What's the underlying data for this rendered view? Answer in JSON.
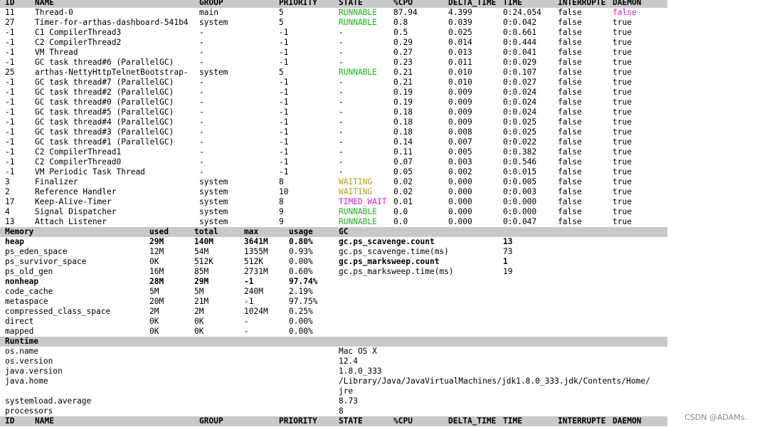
{
  "thread_table": {
    "columns": [
      "ID",
      "NAME",
      "GROUP",
      "PRIORITY",
      "STATE",
      "%CPU",
      "DELTA_TIME",
      "TIME",
      "INTERRUPTE",
      "DAEMON"
    ],
    "rows": [
      [
        "11",
        "Thread-0",
        "main",
        "5",
        "RUNNABLE",
        "87.94",
        "4.399",
        "0:24.054",
        "false",
        "false"
      ],
      [
        "27",
        "Timer-for-arthas-dashboard-541b4",
        "system",
        "5",
        "RUNNABLE",
        "0.8",
        "0.039",
        "0:0.042",
        "false",
        "true"
      ],
      [
        "-1",
        "C1 CompilerThread3",
        "-",
        "-1",
        "-",
        "0.5",
        "0.025",
        "0:0.661",
        "false",
        "true"
      ],
      [
        "-1",
        "C2 CompilerThread2",
        "-",
        "-1",
        "-",
        "0.29",
        "0.014",
        "0:0.444",
        "false",
        "true"
      ],
      [
        "-1",
        "VM Thread",
        "-",
        "-1",
        "-",
        "0.27",
        "0.013",
        "0:0.041",
        "false",
        "true"
      ],
      [
        "-1",
        "GC task thread#6 (ParallelGC)",
        "-",
        "-1",
        "-",
        "0.23",
        "0.011",
        "0:0.029",
        "false",
        "true"
      ],
      [
        "25",
        "arthas-NettyHttpTelnetBootstrap-",
        "system",
        "5",
        "RUNNABLE",
        "0.21",
        "0.010",
        "0:0.107",
        "false",
        "true"
      ],
      [
        "-1",
        "GC task thread#7 (ParallelGC)",
        "-",
        "-1",
        "-",
        "0.21",
        "0.010",
        "0:0.027",
        "false",
        "true"
      ],
      [
        "-1",
        "GC task thread#2 (ParallelGC)",
        "-",
        "-1",
        "-",
        "0.19",
        "0.009",
        "0:0.024",
        "false",
        "true"
      ],
      [
        "-1",
        "GC task thread#0 (ParallelGC)",
        "-",
        "-1",
        "-",
        "0.19",
        "0.009",
        "0:0.024",
        "false",
        "true"
      ],
      [
        "-1",
        "GC task thread#5 (ParallelGC)",
        "-",
        "-1",
        "-",
        "0.18",
        "0.009",
        "0:0.024",
        "false",
        "true"
      ],
      [
        "-1",
        "GC task thread#4 (ParallelGC)",
        "-",
        "-1",
        "-",
        "0.18",
        "0.009",
        "0:0.025",
        "false",
        "true"
      ],
      [
        "-1",
        "GC task thread#3 (ParallelGC)",
        "-",
        "-1",
        "-",
        "0.18",
        "0.008",
        "0:0.025",
        "false",
        "true"
      ],
      [
        "-1",
        "GC task thread#1 (ParallelGC)",
        "-",
        "-1",
        "-",
        "0.14",
        "0.007",
        "0:0.022",
        "false",
        "true"
      ],
      [
        "-1",
        "C2 CompilerThread1",
        "-",
        "-1",
        "-",
        "0.11",
        "0.005",
        "0:0.382",
        "false",
        "true"
      ],
      [
        "-1",
        "C2 CompilerThread0",
        "-",
        "-1",
        "-",
        "0.07",
        "0.003",
        "0:0.546",
        "false",
        "true"
      ],
      [
        "-1",
        "VM Periodic Task Thread",
        "-",
        "-1",
        "-",
        "0.05",
        "0.002",
        "0:0.015",
        "false",
        "true"
      ],
      [
        "3",
        "Finalizer",
        "system",
        "8",
        "WAITING",
        "0.02",
        "0.000",
        "0:0.005",
        "false",
        "true"
      ],
      [
        "2",
        "Reference Handler",
        "system",
        "10",
        "WAITING",
        "0.02",
        "0.000",
        "0:0.003",
        "false",
        "true"
      ],
      [
        "17",
        "Keep-Alive-Timer",
        "system",
        "8",
        "TIMED_WAIT",
        "0.01",
        "0.000",
        "0:0.000",
        "false",
        "true"
      ],
      [
        "4",
        "Signal Dispatcher",
        "system",
        "9",
        "RUNNABLE",
        "0.0",
        "0.000",
        "0:0.000",
        "false",
        "true"
      ],
      [
        "13",
        "Attach Listener",
        "system",
        "9",
        "RUNNABLE",
        "0.0",
        "0.000",
        "0:0.047",
        "false",
        "true"
      ]
    ]
  },
  "memory_header": [
    "Memory",
    "used",
    "total",
    "max",
    "usage",
    "GC"
  ],
  "memory_rows": [
    {
      "name": "heap",
      "used": "29M",
      "total": "140M",
      "max": "3641M",
      "usage": "0.80%",
      "bold": true
    },
    {
      "name": "ps_eden_space",
      "used": "12M",
      "total": "54M",
      "max": "1355M",
      "usage": "0.93%"
    },
    {
      "name": "ps_survivor_space",
      "used": "0K",
      "total": "512K",
      "max": "512K",
      "usage": "0.00%"
    },
    {
      "name": "ps_old_gen",
      "used": "16M",
      "total": "85M",
      "max": "2731M",
      "usage": "0.60%"
    },
    {
      "name": "nonheap",
      "used": "28M",
      "total": "29M",
      "max": "-1",
      "usage": "97.74%",
      "bold": true
    },
    {
      "name": "code_cache",
      "used": "5M",
      "total": "5M",
      "max": "240M",
      "usage": "2.19%"
    },
    {
      "name": "metaspace",
      "used": "20M",
      "total": "21M",
      "max": "-1",
      "usage": "97.75%"
    },
    {
      "name": "compressed_class_space",
      "used": "2M",
      "total": "2M",
      "max": "1024M",
      "usage": "0.25%"
    },
    {
      "name": "direct",
      "used": "0K",
      "total": "0K",
      "max": "-",
      "usage": "0.00%"
    },
    {
      "name": "mapped",
      "used": "0K",
      "total": "0K",
      "max": "-",
      "usage": "0.00%"
    }
  ],
  "gc_rows": [
    {
      "name": "gc.ps_scavenge.count",
      "value": "13",
      "bold": true
    },
    {
      "name": "gc.ps_scavenge.time(ms)",
      "value": "73"
    },
    {
      "name": "gc.ps_marksweep.count",
      "value": "1",
      "bold": true
    },
    {
      "name": "gc.ps_marksweep.time(ms)",
      "value": "19"
    }
  ],
  "runtime_header": "Runtime",
  "runtime_rows": [
    {
      "key": "os.name",
      "value": "Mac OS X"
    },
    {
      "key": "os.version",
      "value": "12.4"
    },
    {
      "key": "java.version",
      "value": "1.8.0_333"
    },
    {
      "key": "java.home",
      "value": "/Library/Java/JavaVirtualMachines/jdk1.8.0_333.jdk/Contents/Home/",
      "value2": "jre"
    },
    {
      "key": "systemload.average",
      "value": "8.73"
    },
    {
      "key": "processors",
      "value": "8"
    }
  ],
  "state_colors": {
    "RUNNABLE": "#19b418",
    "WAITING": "#b6a410",
    "TIMED_WAIT": "#d01ed0"
  },
  "watermark": "CSDN @ADAMs."
}
